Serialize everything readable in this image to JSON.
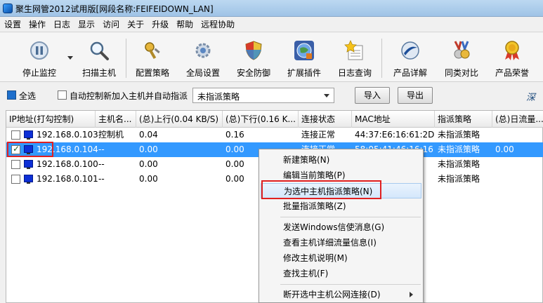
{
  "window": {
    "title": "聚生网管2012试用版[网段名称:FEIFEIDOWN_LAN]"
  },
  "menu": [
    "设置",
    "操作",
    "日志",
    "显示",
    "访问",
    "关于",
    "升级",
    "帮助",
    "远程协助"
  ],
  "toolbar": {
    "stop_monitor": "停止监控",
    "scan_host": "扫描主机",
    "config_policy": "配置策略",
    "global_settings": "全局设置",
    "security": "安全防御",
    "plugins": "扩展插件",
    "log_query": "日志查询",
    "product_details": "产品详解",
    "compare": "同类对比",
    "honors": "产品荣誉"
  },
  "filter": {
    "select_all": "全选",
    "auto_control": "自动控制新加入主机并自动指派",
    "policy_value": "未指派策略",
    "import_label": "导入",
    "export_label": "导出",
    "deep": "深"
  },
  "table": {
    "headers": [
      "IP地址(打勾控制)",
      "主机名...",
      "(总)上行(0.04 KB/S)",
      "(总)下行(0.16 K...",
      "连接状态",
      "MAC地址",
      "指派策略",
      "(总)日流量..."
    ],
    "rows": [
      {
        "ip": "192.168.0.103",
        "host": "控制机",
        "up": "0.04",
        "down": "0.16",
        "status": "连接正常",
        "mac": "44:37:E6:16:61:2D",
        "policy": "未指派策略",
        "daily": ""
      },
      {
        "ip": "192.168.0.104",
        "host": "--",
        "up": "0.00",
        "down": "0.00",
        "status": "连接正常",
        "mac": "58:05:41:46:16:16",
        "policy": "未指派策略",
        "daily": "0.00"
      },
      {
        "ip": "192.168.0.100",
        "host": "--",
        "up": "0.00",
        "down": "0.00",
        "status": "",
        "mac": "",
        "policy": "未指派策略",
        "daily": ""
      },
      {
        "ip": "192.168.0.101",
        "host": "--",
        "up": "0.00",
        "down": "0.00",
        "status": "",
        "mac": "",
        "policy": "未指派策略",
        "daily": ""
      }
    ]
  },
  "context_menu": {
    "new_policy": "新建策略(N)",
    "edit_policy": "编辑当前策略(P)",
    "assign_policy": "为选中主机指派策略(N)",
    "batch_assign": "批量指派策略(Z)",
    "send_message": "发送Windows信使消息(G)",
    "traffic_info": "查看主机详细流量信息(I)",
    "edit_host": "修改主机说明(M)",
    "find_host": "查找主机(F)",
    "disconnect": "断开选中主机公网连接(D)"
  },
  "colors": {
    "selection": "#3399ff",
    "highlight_box": "#e02020"
  }
}
